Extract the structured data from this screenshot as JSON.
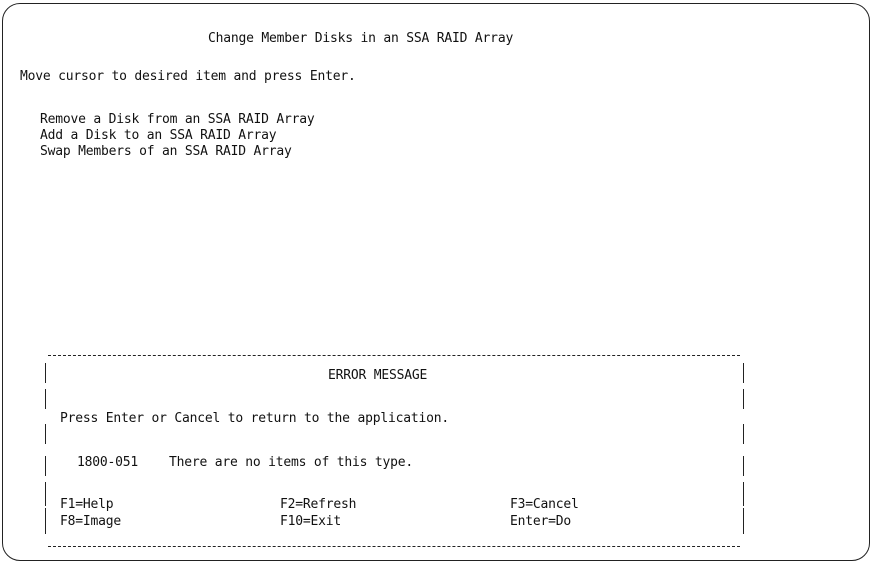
{
  "screen": {
    "title": "Change Member Disks in an SSA RAID Array",
    "instruction": "Move cursor to desired item and press Enter.",
    "menu_items": [
      "Remove a Disk from an SSA RAID Array",
      "Add a Disk to an SSA RAID Array",
      "Swap Members of an SSA RAID Array"
    ]
  },
  "dialog": {
    "title": "ERROR MESSAGE",
    "message": "Press Enter or Cancel to return to the application.",
    "error_code": "1800-051",
    "error_text": "There are no items of this type.",
    "function_keys": [
      "F1=Help",
      "F2=Refresh",
      "F3=Cancel",
      "F8=Image",
      "F10=Exit",
      "Enter=Do"
    ]
  }
}
